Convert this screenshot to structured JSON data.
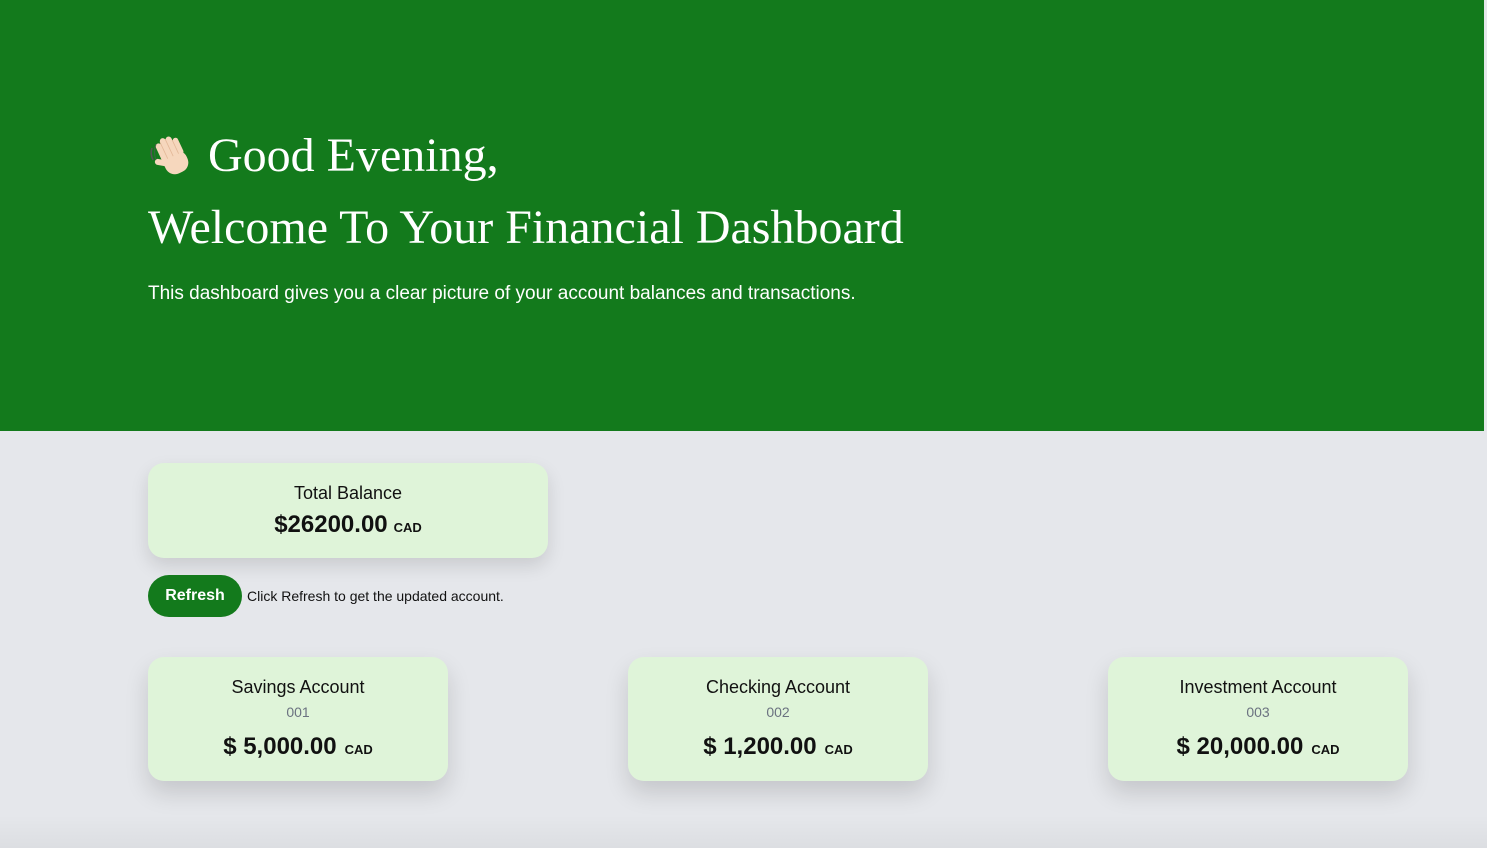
{
  "colors": {
    "hero_bg": "#137a1c",
    "page_bg": "#e5e7eb",
    "card_bg": "#dff4d9",
    "button_bg": "#137a1c"
  },
  "hero": {
    "greeting_icon": "waving-hand-icon",
    "greeting": "Good Evening,",
    "title": "Welcome To Your Financial Dashboard",
    "description": "This dashboard gives you a clear picture of your account balances and transactions."
  },
  "total": {
    "label": "Total Balance",
    "amount": "$26200.00",
    "currency": "CAD"
  },
  "refresh": {
    "button_label": "Refresh",
    "hint": "Click Refresh to get the updated account."
  },
  "accounts": [
    {
      "name": "Savings Account",
      "number": "001",
      "amount": "$ 5,000.00",
      "currency": "CAD"
    },
    {
      "name": "Checking Account",
      "number": "002",
      "amount": "$ 1,200.00",
      "currency": "CAD"
    },
    {
      "name": "Investment Account",
      "number": "003",
      "amount": "$ 20,000.00",
      "currency": "CAD"
    }
  ]
}
